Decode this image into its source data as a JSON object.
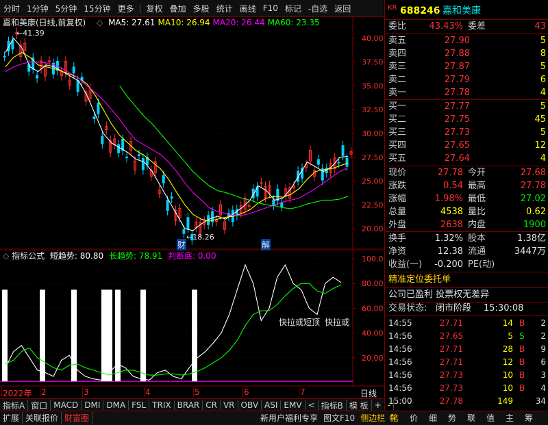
{
  "toolbar": {
    "items": [
      "分时",
      "1分钟",
      "5分钟",
      "15分钟",
      "更多",
      "复权",
      "叠加",
      "多股",
      "统计",
      "画线",
      "F10",
      "标记",
      "-自选",
      "返回"
    ]
  },
  "main_chart": {
    "title": "嘉和美康(日线,前复权)",
    "ma_labels": [
      {
        "name": "MA5: 27.61",
        "color": "#ffffff"
      },
      {
        "name": "MA10: 26.94",
        "color": "#ffff00"
      },
      {
        "name": "MA20: 26.44",
        "color": "#ff00ff"
      },
      {
        "name": "MA60: 23.35",
        "color": "#00ff00"
      }
    ],
    "high_note": "41.39",
    "low_note": "18.26",
    "price_ticks": [
      "40.00",
      "37.50",
      "35.00",
      "32.50",
      "30.00",
      "27.50",
      "25.00",
      "22.50",
      "20.00"
    ],
    "marker_cai": "财",
    "marker_jie": "解"
  },
  "chart_data": [
    {
      "type": "line",
      "title": "嘉和美康(日线,前复权)",
      "y_ticks": [
        40.0,
        37.5,
        35.0,
        32.5,
        30.0,
        27.5,
        25.0,
        22.5,
        20.0
      ],
      "ylim": [
        18,
        42
      ],
      "series": [
        {
          "name": "MA5",
          "color": "#ffffff",
          "values": [
            38.5,
            40.0,
            39.0,
            37.0,
            36.5,
            37.2,
            37.0,
            36.5,
            36.0,
            35.5,
            34.0,
            32.0,
            30.0,
            29.0,
            28.5,
            28.0,
            27.3,
            27.0,
            26.0,
            24.5,
            23.0,
            21.5,
            20.0,
            19.8,
            20.5,
            21.0,
            21.3,
            21.0,
            21.6,
            22.2,
            23.0,
            24.5,
            24.0,
            23.0,
            23.2,
            24.2,
            25.6,
            27.0,
            26.5,
            26.0,
            26.5,
            27.5,
            27.6
          ]
        },
        {
          "name": "MA10",
          "color": "#ffff00",
          "values": [
            37.0,
            38.0,
            38.5,
            38.0,
            37.2,
            37.0,
            36.8,
            36.5,
            36.2,
            35.8,
            35.2,
            34.0,
            32.5,
            31.0,
            29.8,
            29.0,
            28.2,
            27.7,
            27.0,
            26.3,
            25.2,
            23.8,
            22.5,
            21.5,
            21.0,
            20.8,
            21.0,
            21.2,
            21.3,
            21.6,
            22.0,
            22.7,
            23.2,
            23.4,
            23.3,
            23.6,
            24.2,
            25.2,
            26.0,
            26.2,
            26.3,
            26.6,
            26.9
          ]
        },
        {
          "name": "MA20",
          "color": "#ff00ff",
          "values": [
            36.5,
            37.0,
            37.3,
            37.5,
            37.5,
            37.4,
            37.2,
            36.8,
            36.3,
            35.8,
            35.0,
            34.3,
            33.5,
            32.5,
            31.5,
            30.3,
            29.3,
            28.8,
            28.3,
            27.8,
            27.0,
            26.0,
            24.8,
            23.8,
            23.0,
            22.2,
            21.8,
            21.6,
            21.4,
            21.4,
            21.6,
            21.9,
            22.2,
            22.5,
            22.8,
            23.0,
            23.2,
            23.7,
            24.2,
            24.8,
            25.4,
            26.0,
            26.4
          ]
        },
        {
          "name": "MA60",
          "color": "#00ff00",
          "values": [
            null,
            null,
            null,
            null,
            null,
            null,
            null,
            null,
            null,
            null,
            null,
            null,
            null,
            null,
            35.0,
            33.8,
            32.8,
            31.8,
            31.0,
            30.0,
            29.0,
            28.0,
            27.0,
            26.0,
            25.2,
            24.5,
            24.0,
            23.8,
            23.5,
            23.2,
            23.0,
            22.7,
            22.5,
            22.4,
            22.2,
            22.1,
            22.3,
            22.6,
            22.8,
            23.0,
            23.0,
            23.1,
            23.4
          ]
        }
      ]
    },
    {
      "type": "line",
      "title": "指标公式",
      "y_ticks": [
        100.0,
        80.0,
        60.0,
        40.0,
        20.0
      ],
      "ylim": [
        0,
        105
      ],
      "series": [
        {
          "name": "短趋势",
          "color": "#ffffff",
          "values": [
            12,
            25,
            30,
            20,
            10,
            8,
            5,
            18,
            22,
            10,
            5,
            3,
            2,
            8,
            15,
            12,
            5,
            3,
            2,
            8,
            10,
            5,
            3,
            12,
            20,
            25,
            32,
            40,
            55,
            75,
            95,
            80,
            50,
            60,
            85,
            95,
            80,
            75,
            60,
            55,
            80,
            85,
            80.8
          ]
        },
        {
          "name": "长趋势",
          "color": "#00ff00",
          "values": [
            15,
            18,
            25,
            28,
            20,
            16,
            12,
            10,
            14,
            15,
            12,
            10,
            8,
            6,
            8,
            10,
            10,
            8,
            6,
            6,
            7,
            7,
            6,
            7,
            9,
            12,
            16,
            20,
            26,
            34,
            46,
            55,
            58,
            58,
            63,
            70,
            76,
            80,
            80,
            74,
            72,
            76,
            78.91
          ]
        }
      ]
    }
  ],
  "indicator": {
    "title": "指标公式",
    "s1": "短趋势: 80.80",
    "s2": "长趋势: 78.91",
    "s3": "判断底: 0.00",
    "ticks": [
      "100.0",
      "80.00",
      "60.00",
      "40.00",
      "20.00"
    ],
    "note1": "快拉或短顶",
    "note2": "快拉或"
  },
  "xaxis": {
    "labels": [
      "2022年",
      "2",
      "3",
      "4",
      "5",
      "6",
      "7"
    ],
    "right": "日线"
  },
  "tabs": [
    "指标A",
    "窗口",
    "MACD",
    "DMI",
    "DMA",
    "FSL",
    "TRIX",
    "BRAR",
    "CR",
    "VR",
    "OBV",
    "ASI",
    "EMV",
    "<",
    "指标B",
    "模 板",
    "+",
    "-"
  ],
  "quote": {
    "code_prefix": "KR",
    "code": "688246",
    "name": "嘉和美康",
    "weibi_label": "委比",
    "weibi": "43.43%",
    "weicha_label": "委差",
    "weicha": "43",
    "asks": [
      {
        "l": "卖五",
        "p": "27.90",
        "v": "5"
      },
      {
        "l": "卖四",
        "p": "27.88",
        "v": "8"
      },
      {
        "l": "卖三",
        "p": "27.87",
        "v": "5"
      },
      {
        "l": "卖二",
        "p": "27.79",
        "v": "6"
      },
      {
        "l": "卖一",
        "p": "27.78",
        "v": "4"
      }
    ],
    "bids": [
      {
        "l": "买一",
        "p": "27.77",
        "v": "5"
      },
      {
        "l": "买二",
        "p": "27.75",
        "v": "45"
      },
      {
        "l": "买三",
        "p": "27.73",
        "v": "5"
      },
      {
        "l": "买四",
        "p": "27.65",
        "v": "12"
      },
      {
        "l": "买五",
        "p": "27.64",
        "v": "4"
      }
    ],
    "stats": [
      {
        "l1": "现价",
        "v1": "27.78",
        "c1": "red",
        "l2": "今开",
        "v2": "27.68",
        "c2": "red"
      },
      {
        "l1": "涨跌",
        "v1": "0.54",
        "c1": "red",
        "l2": "最高",
        "v2": "27.78",
        "c2": "red"
      },
      {
        "l1": "涨幅",
        "v1": "1.98%",
        "c1": "red",
        "l2": "最低",
        "v2": "27.02",
        "c2": "green"
      },
      {
        "l1": "总量",
        "v1": "4538",
        "c1": "yellow",
        "l2": "量比",
        "v2": "0.62",
        "c2": "yellow"
      },
      {
        "l1": "外盘",
        "v1": "2638",
        "c1": "red",
        "l2": "内盘",
        "v2": "1900",
        "c2": "green"
      }
    ],
    "stats2": [
      {
        "l1": "换手",
        "v1": "1.32%",
        "l2": "股本",
        "v2": "1.38亿"
      },
      {
        "l1": "净资",
        "v1": "12.38",
        "l2": "流通",
        "v2": "3447万"
      },
      {
        "l1": "收益(一)",
        "v1": "-0.200",
        "l2": "PE(动)",
        "v2": ""
      }
    ],
    "precise": "精准定位委托单",
    "info": "公司已盈利 投票权无差异",
    "status_label": "交易状态:",
    "status": "闭市阶段",
    "status_time": "15:30:08",
    "ticks": [
      {
        "t": "14:55",
        "p": "27.71",
        "v": "14",
        "s": "B",
        "n": "2"
      },
      {
        "t": "14:56",
        "p": "27.65",
        "v": "5",
        "s": "S",
        "n": "2"
      },
      {
        "t": "14:56",
        "p": "27.71",
        "v": "28",
        "s": "B",
        "n": "9"
      },
      {
        "t": "14:56",
        "p": "27.71",
        "v": "12",
        "s": "B",
        "n": "6"
      },
      {
        "t": "14:56",
        "p": "27.73",
        "v": "10",
        "s": "B",
        "n": "3"
      },
      {
        "t": "14:56",
        "p": "27.73",
        "v": "10",
        "s": "B",
        "n": "4"
      },
      {
        "t": "15:00",
        "p": "27.78",
        "v": "149",
        "s": "",
        "n": "34"
      }
    ]
  },
  "bottom": {
    "left": [
      "扩展",
      "关联报价",
      "财富圈"
    ],
    "mid": [
      "新用户福利专享",
      "图文F10",
      "侧边栏《"
    ],
    "right": [
      "笔",
      "价",
      "细",
      "势",
      "联",
      "值",
      "主",
      "筹"
    ]
  }
}
